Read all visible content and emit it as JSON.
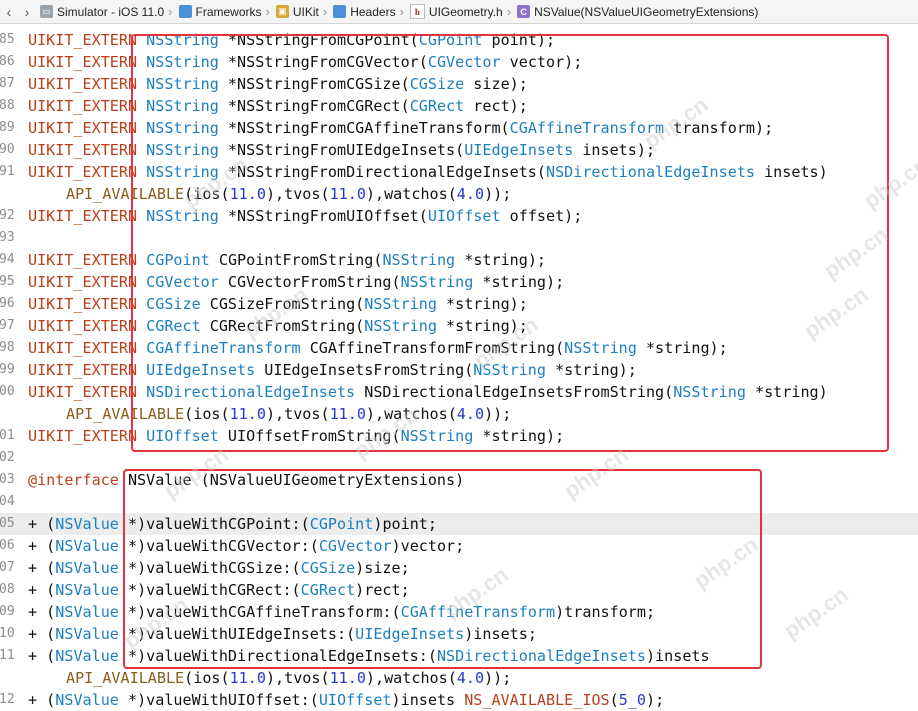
{
  "jumpbar": {
    "back_glyph": "‹",
    "forward_glyph": "›",
    "crumbs": [
      {
        "label": "Simulator - iOS 11.0",
        "icon": "simulator-icon"
      },
      {
        "label": "Frameworks",
        "icon": "folder-icon"
      },
      {
        "label": "UIKit",
        "icon": "framework-icon"
      },
      {
        "label": "Headers",
        "icon": "folder-icon"
      },
      {
        "label": "UIGeometry.h",
        "icon": "header-file-icon"
      },
      {
        "label": "NSValue(NSValueUIGeometryExtensions)",
        "icon": "category-icon"
      }
    ],
    "separator": "›"
  },
  "colors": {
    "keyword": "#b8411b",
    "type": "#1c7fbf",
    "number": "#2736cf",
    "macro": "#8a5d1f",
    "highlight_box": "#e5333d",
    "current_line": "#ececec"
  },
  "editor": {
    "current_line_number": "105",
    "lines": [
      {
        "ln": "85",
        "code": "UIKIT_EXTERN NSString *NSStringFromCGPoint(CGPoint point);"
      },
      {
        "ln": "86",
        "code": "UIKIT_EXTERN NSString *NSStringFromCGVector(CGVector vector);"
      },
      {
        "ln": "87",
        "code": "UIKIT_EXTERN NSString *NSStringFromCGSize(CGSize size);"
      },
      {
        "ln": "88",
        "code": "UIKIT_EXTERN NSString *NSStringFromCGRect(CGRect rect);"
      },
      {
        "ln": "89",
        "code": "UIKIT_EXTERN NSString *NSStringFromCGAffineTransform(CGAffineTransform transform);"
      },
      {
        "ln": "90",
        "code": "UIKIT_EXTERN NSString *NSStringFromUIEdgeInsets(UIEdgeInsets insets);"
      },
      {
        "ln": "91",
        "code": "UIKIT_EXTERN NSString *NSStringFromDirectionalEdgeInsets(NSDirectionalEdgeInsets insets)"
      },
      {
        "ln": "",
        "code": "API_AVAILABLE(ios(11.0),tvos(11.0),watchos(4.0));"
      },
      {
        "ln": "92",
        "code": "UIKIT_EXTERN NSString *NSStringFromUIOffset(UIOffset offset);"
      },
      {
        "ln": "93",
        "code": ""
      },
      {
        "ln": "94",
        "code": "UIKIT_EXTERN CGPoint CGPointFromString(NSString *string);"
      },
      {
        "ln": "95",
        "code": "UIKIT_EXTERN CGVector CGVectorFromString(NSString *string);"
      },
      {
        "ln": "96",
        "code": "UIKIT_EXTERN CGSize CGSizeFromString(NSString *string);"
      },
      {
        "ln": "97",
        "code": "UIKIT_EXTERN CGRect CGRectFromString(NSString *string);"
      },
      {
        "ln": "98",
        "code": "UIKIT_EXTERN CGAffineTransform CGAffineTransformFromString(NSString *string);"
      },
      {
        "ln": "99",
        "code": "UIKIT_EXTERN UIEdgeInsets UIEdgeInsetsFromString(NSString *string);"
      },
      {
        "ln": "00",
        "code": "UIKIT_EXTERN NSDirectionalEdgeInsets NSDirectionalEdgeInsetsFromString(NSString *string)"
      },
      {
        "ln": "",
        "code": "API_AVAILABLE(ios(11.0),tvos(11.0),watchos(4.0));"
      },
      {
        "ln": "01",
        "code": "UIKIT_EXTERN UIOffset UIOffsetFromString(NSString *string);"
      },
      {
        "ln": "02",
        "code": ""
      },
      {
        "ln": "03",
        "code": "@interface NSValue (NSValueUIGeometryExtensions)"
      },
      {
        "ln": "04",
        "code": ""
      },
      {
        "ln": "05",
        "code": "+ (NSValue *)valueWithCGPoint:(CGPoint)point;"
      },
      {
        "ln": "06",
        "code": "+ (NSValue *)valueWithCGVector:(CGVector)vector;"
      },
      {
        "ln": "07",
        "code": "+ (NSValue *)valueWithCGSize:(CGSize)size;"
      },
      {
        "ln": "08",
        "code": "+ (NSValue *)valueWithCGRect:(CGRect)rect;"
      },
      {
        "ln": "09",
        "code": "+ (NSValue *)valueWithCGAffineTransform:(CGAffineTransform)transform;"
      },
      {
        "ln": "10",
        "code": "+ (NSValue *)valueWithUIEdgeInsets:(UIEdgeInsets)insets;"
      },
      {
        "ln": "11",
        "code": "+ (NSValue *)valueWithDirectionalEdgeInsets:(NSDirectionalEdgeInsets)insets"
      },
      {
        "ln": "",
        "code": "API_AVAILABLE(ios(11.0),tvos(11.0),watchos(4.0));"
      },
      {
        "ln": "12",
        "code": "+ (NSValue *)valueWithUIOffset:(UIOffset)insets NS_AVAILABLE_IOS(5_0);"
      }
    ]
  },
  "watermark": "php.cn"
}
